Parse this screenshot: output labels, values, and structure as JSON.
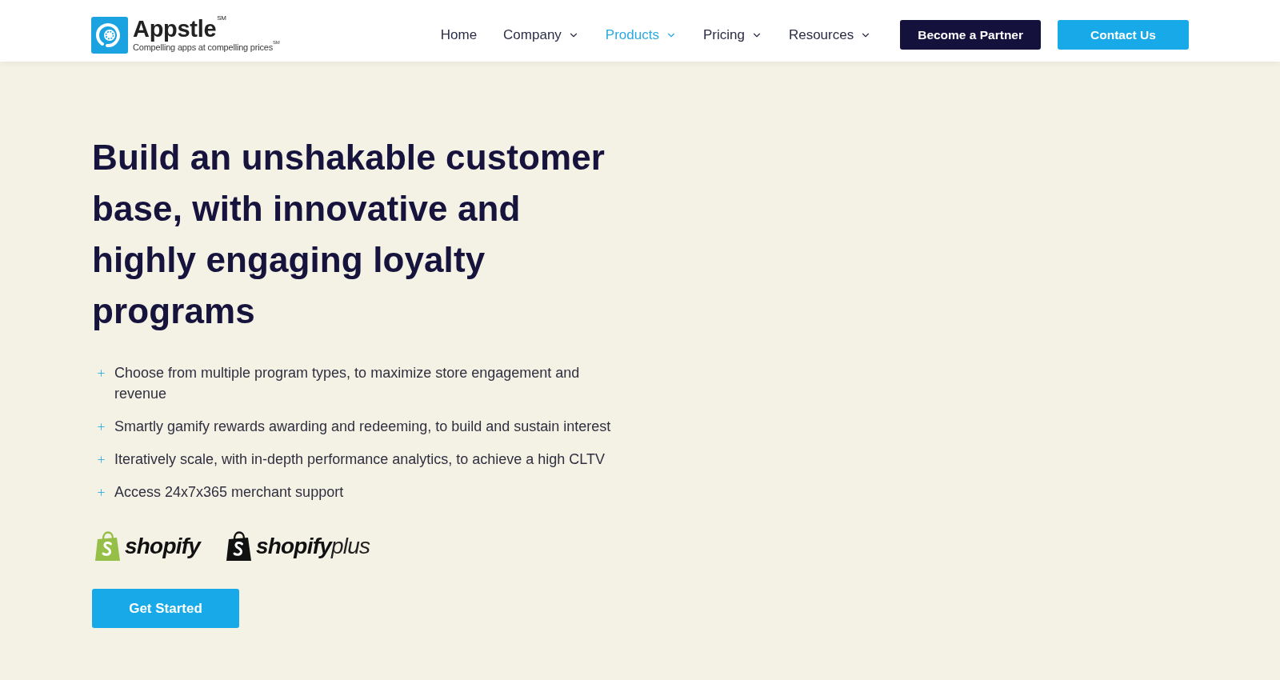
{
  "header": {
    "brand": {
      "name": "Appstle$^{SM}$",
      "tagline": "Compelling apps at compelling prices$^{SM}$"
    },
    "nav": [
      {
        "label": "Home",
        "dropdown": false,
        "selected": false
      },
      {
        "label": "Company",
        "dropdown": true,
        "selected": false
      },
      {
        "label": "Products",
        "dropdown": true,
        "selected": true
      },
      {
        "label": "Pricing",
        "dropdown": true,
        "selected": false
      },
      {
        "label": "Resources",
        "dropdown": true,
        "selected": false
      }
    ],
    "buttons": [
      {
        "label": "Become a Partner",
        "kind": "dark"
      },
      {
        "label": "Contact Us",
        "kind": "primary"
      }
    ]
  },
  "hero": {
    "headline": "Build an unshakable customer base, with innovative and highly engaging loyalty programs",
    "bullets": [
      "Choose from multiple program types, to maximize store engagement and revenue",
      "Smartly gamify rewards awarding and redeeming, to build and sustain interest",
      "Iteratively scale, with in-depth performance analytics, to achieve a high CLTV",
      "Access 24x7x365 merchant support"
    ],
    "platforms": [
      {
        "wordmark": "shopify",
        "color": "#95bf47"
      },
      {
        "wordmark": "shopify",
        "suffix": "plus",
        "color": "#111111"
      }
    ],
    "cta": "Get Started"
  }
}
